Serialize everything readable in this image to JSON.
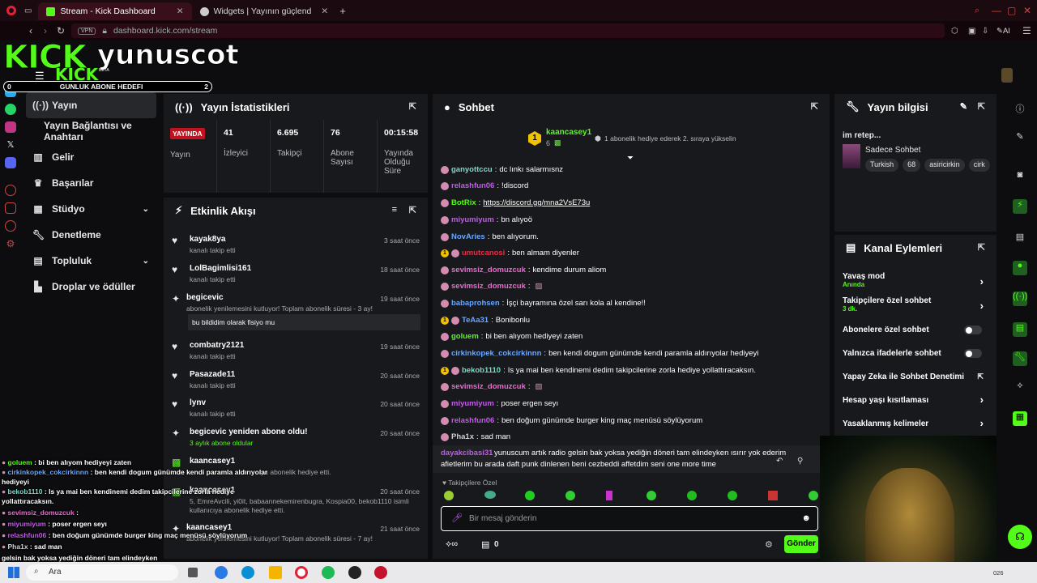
{
  "browser": {
    "tabs": [
      {
        "title": "Stream - Kick Dashboard"
      },
      {
        "title": "Widgets | Yayının güçlend"
      }
    ],
    "url": "dashboard.kick.com/stream",
    "vpn": "VPN",
    "ai": "AI"
  },
  "overlay": {
    "logo": "KICK",
    "username": "yunuscot",
    "beta": "BETA",
    "goal_left": "0",
    "goal_label": "GUNLUK ABONE HEDEFI",
    "goal_right": "2"
  },
  "nav": {
    "items": [
      {
        "label": "Yayın"
      },
      {
        "label": "Yayın Bağlantısı ve Anahtarı"
      },
      {
        "label": "Gelir"
      },
      {
        "label": "Başarılar"
      },
      {
        "label": "Stüdyo"
      },
      {
        "label": "Denetleme"
      },
      {
        "label": "Topluluk"
      },
      {
        "label": "Droplar ve ödüller"
      }
    ]
  },
  "stats": {
    "title": "Yayın İstatistikleri",
    "live_badge": "YAYINDA",
    "live_label": "Yayın",
    "viewers": "41",
    "viewers_label": "İzleyici",
    "followers": "6.695",
    "followers_label": "Takipçi",
    "subs": "76",
    "subs_label": "Abone Sayısı",
    "duration": "00:15:58",
    "duration_label": "Yayında Olduğu Süre"
  },
  "activity": {
    "title": "Etkinlik Akışı",
    "items": [
      {
        "name": "kayak8ya",
        "sub": "kanalı takip etti",
        "time": "3 saat önce"
      },
      {
        "name": "LolBagimlisi161",
        "sub": "kanalı takip etti",
        "time": "18 saat önce"
      },
      {
        "name": "begicevic",
        "sub": "abonelik yenilemesini kutluyor! Toplam abonelik süresi - 3 ay!",
        "time": "19 saat önce",
        "quote": "bu bildidim olarak fisiyo mu"
      },
      {
        "name": "combatry2121",
        "sub": "kanalı takip etti",
        "time": "19 saat önce"
      },
      {
        "name": "Pasazade11",
        "sub": "kanalı takip etti",
        "time": "20 saat önce"
      },
      {
        "name": "lynv",
        "sub": "kanalı takip etti",
        "time": "20 saat önce"
      },
      {
        "name": "begicevic yeniden abone oldu!",
        "sub": "3 aylık abone oldular",
        "time": "20 saat önce"
      },
      {
        "name": "kaancasey1",
        "sub": "ya abonelik hediye etti.",
        "time": ""
      },
      {
        "name": "kaancasey1",
        "sub": "5, EmreAvcili, yi0it, babaannekemirenbugra, Kospia00, bekob1110 isimli kullanıcıya abonelik hediye etti.",
        "time": "20 saat önce"
      },
      {
        "name": "kaancasey1",
        "sub": "abonelik yenilemesini kutluyor! Toplam abonelik süresi - 7 ay!",
        "time": "21 saat önce"
      }
    ]
  },
  "chat": {
    "title": "Sohbet",
    "pinned_user": "kaancasey1",
    "pinned_count": "6",
    "pinned_msg": "1 abonelik hediye ederek 2. sıraya yükselin",
    "messages": [
      {
        "user": "ganyottccu",
        "color": "#7dd8c8",
        "text": "dc lınkı salarmısnz"
      },
      {
        "user": "relashfun06",
        "color": "#c05ce8",
        "text": "!discord"
      },
      {
        "user": "BotRix",
        "color": "#53fc18",
        "text": "https://discord.gg/mna2VsE73u"
      },
      {
        "user": "miyumiyum",
        "color": "#c05ce8",
        "text": "bn alıyoö"
      },
      {
        "user": "NovAries",
        "color": "#6aa7ff",
        "text": "ben alıyorum."
      },
      {
        "user": "umutcanosi",
        "color": "#e0304a",
        "text": "ben almam diyenler"
      },
      {
        "user": "sevimsiz_domuzcuk",
        "color": "#e86bd0",
        "text": "kendime durum aliom"
      },
      {
        "user": "sevimsiz_domuzcuk",
        "color": "#e86bd0",
        "text": ""
      },
      {
        "user": "babaprohsen",
        "color": "#6aa7ff",
        "text": "İşçi bayramına özel sarı kola al kendine!!"
      },
      {
        "user": "TeAa31",
        "color": "#6aa7ff",
        "text": "Bonibonlu"
      },
      {
        "user": "goluem",
        "color": "#53fc18",
        "text": "bi ben alıyom hediyeyi zaten"
      },
      {
        "user": "cirkinkopek_cokcirkinnn",
        "color": "#6aa7ff",
        "text": "ben kendi dogum günümde kendi paramla aldırıyolar hediyeyi"
      },
      {
        "user": "bekob1110",
        "color": "#7dd8c8",
        "text": "Is ya mai ben kendinemi dedim takipcilerine zorla hediye yollattıracaksın."
      },
      {
        "user": "sevimsiz_domuzcuk",
        "color": "#e86bd0",
        "text": ""
      },
      {
        "user": "miyumiyum",
        "color": "#c05ce8",
        "text": "poser ergen seyı"
      },
      {
        "user": "relashfun06",
        "color": "#c05ce8",
        "text": "ben doğum günümde burger king maç menüsü söylüyorum"
      },
      {
        "user": "Pha1x",
        "color": "#cfcfcf",
        "text": "sad man"
      }
    ],
    "reply_user": "dayakcibasi31",
    "reply_text": "yunuscum artık radio gelsin bak yoksa yediğin döneri tam elindeyken ısırır yok ederim",
    "reply_text2": "afietlerim bu arada daft punk dinlenen beni cezbeddi affetdim seni one more time",
    "followers_only": "Takipçilere Özel",
    "placeholder": "Bir mesaj gönderin",
    "points": "0",
    "send": "Gönder"
  },
  "info": {
    "title": "Yayın bilgisi",
    "stream_title": "im retep...",
    "category": "Sadece Sohbet",
    "tags": [
      "Turkish",
      "68",
      "asiricirkin",
      "cirk"
    ]
  },
  "actions": {
    "title": "Kanal Eylemleri",
    "rows": [
      {
        "label": "Yavaş mod",
        "sub": "Anında"
      },
      {
        "label": "Takipçilere özel sohbet",
        "sub": "3 dk."
      },
      {
        "label": "Abonelere özel sohbet",
        "sub": ""
      },
      {
        "label": "Yalnızca ifadelerle sohbet",
        "sub": ""
      },
      {
        "label": "Yapay Zeka ile Sohbet Denetimi",
        "sub": ""
      },
      {
        "label": "Hesap yaşı kısıtlaması",
        "sub": ""
      },
      {
        "label": "Yasaklanmış kelimeler",
        "sub": ""
      }
    ]
  },
  "overlay_chat": [
    {
      "user": "goluem",
      "color": "#53fc18",
      "text": "bi ben alıyom hediyeyi zaten"
    },
    {
      "user": "cirkinkopek_cokcirkinnn",
      "color": "#6aa7ff",
      "text": "ben kendi dogum günümde kendi paramla aldırıyolar"
    },
    {
      "user": "",
      "color": "#fff",
      "text": "hediyeyi"
    },
    {
      "user": "bekob1110",
      "color": "#7dd8c8",
      "text": "Is ya mai ben kendinemi dedim takipcilerine zorla hediye"
    },
    {
      "user": "",
      "color": "#fff",
      "text": "yollattıracaksın."
    },
    {
      "user": "sevimsiz_domuzcuk",
      "color": "#e86bd0",
      "text": ""
    },
    {
      "user": "miyumiyum",
      "color": "#c05ce8",
      "text": "poser ergen seyı"
    },
    {
      "user": "relashfun06",
      "color": "#c05ce8",
      "text": "ben doğum günümde burger king maç menüsü söylüyorum"
    },
    {
      "user": "Pha1x",
      "color": "#cfcfcf",
      "text": "sad man"
    },
    {
      "user": "",
      "color": "#fff",
      "text": "gelsin bak yoksa yediğin döneri tam elindeyken"
    }
  ],
  "taskbar": {
    "search": "Ara",
    "clock": "026"
  }
}
